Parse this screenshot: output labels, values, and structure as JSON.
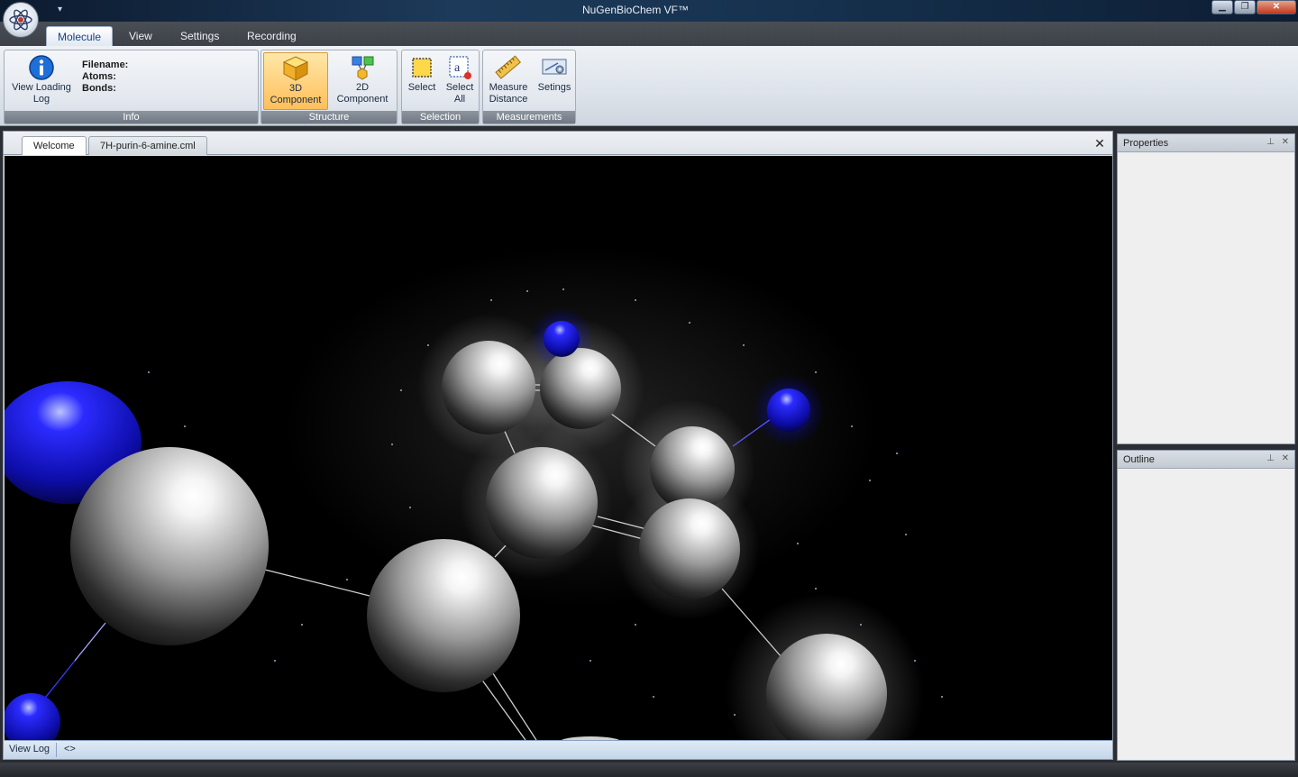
{
  "app": {
    "title": "NuGenBioChem VF™",
    "orb_icon": "atom-icon",
    "quick_access_arrow": "▾"
  },
  "window_controls": {
    "minimize": "▁",
    "restore": "❐",
    "close": "✕"
  },
  "ribbon_tabs": [
    {
      "label": "Molecule",
      "active": true
    },
    {
      "label": "View",
      "active": false
    },
    {
      "label": "Settings",
      "active": false
    },
    {
      "label": "Recording",
      "active": false
    }
  ],
  "ribbon": {
    "info": {
      "label": "Info",
      "view_log_button": "View Loading Log",
      "filename_label": "Filename:",
      "atoms_label": "Atoms:",
      "bonds_label": "Bonds:"
    },
    "structure": {
      "label": "Structure",
      "btn_3d": "3D Component",
      "btn_2d": "2D Component"
    },
    "selection": {
      "label": "Selection",
      "select": "Select",
      "select_all": "Select All"
    },
    "measurements": {
      "label": "Measurements",
      "measure_distance": "Measure Distance",
      "settings": "Setings"
    }
  },
  "document": {
    "tabs": [
      {
        "label": "Welcome"
      },
      {
        "label": "7H-purin-6-amine.cml"
      }
    ],
    "close_glyph": "✕",
    "log_label": "View Log",
    "log_nav": "<>"
  },
  "panels": {
    "properties": {
      "title": "Properties",
      "pin": "📌",
      "close": "✕"
    },
    "outline": {
      "title": "Outline",
      "pin": "📌",
      "close": "✕"
    }
  },
  "colors": {
    "accent_hot": "#ffbf5a",
    "ribbon_label": "#6f7883",
    "nitrogen_atom": "#1a1ae6",
    "carbon_atom": "#d8d8d8",
    "viewport_bg": "#000000"
  }
}
